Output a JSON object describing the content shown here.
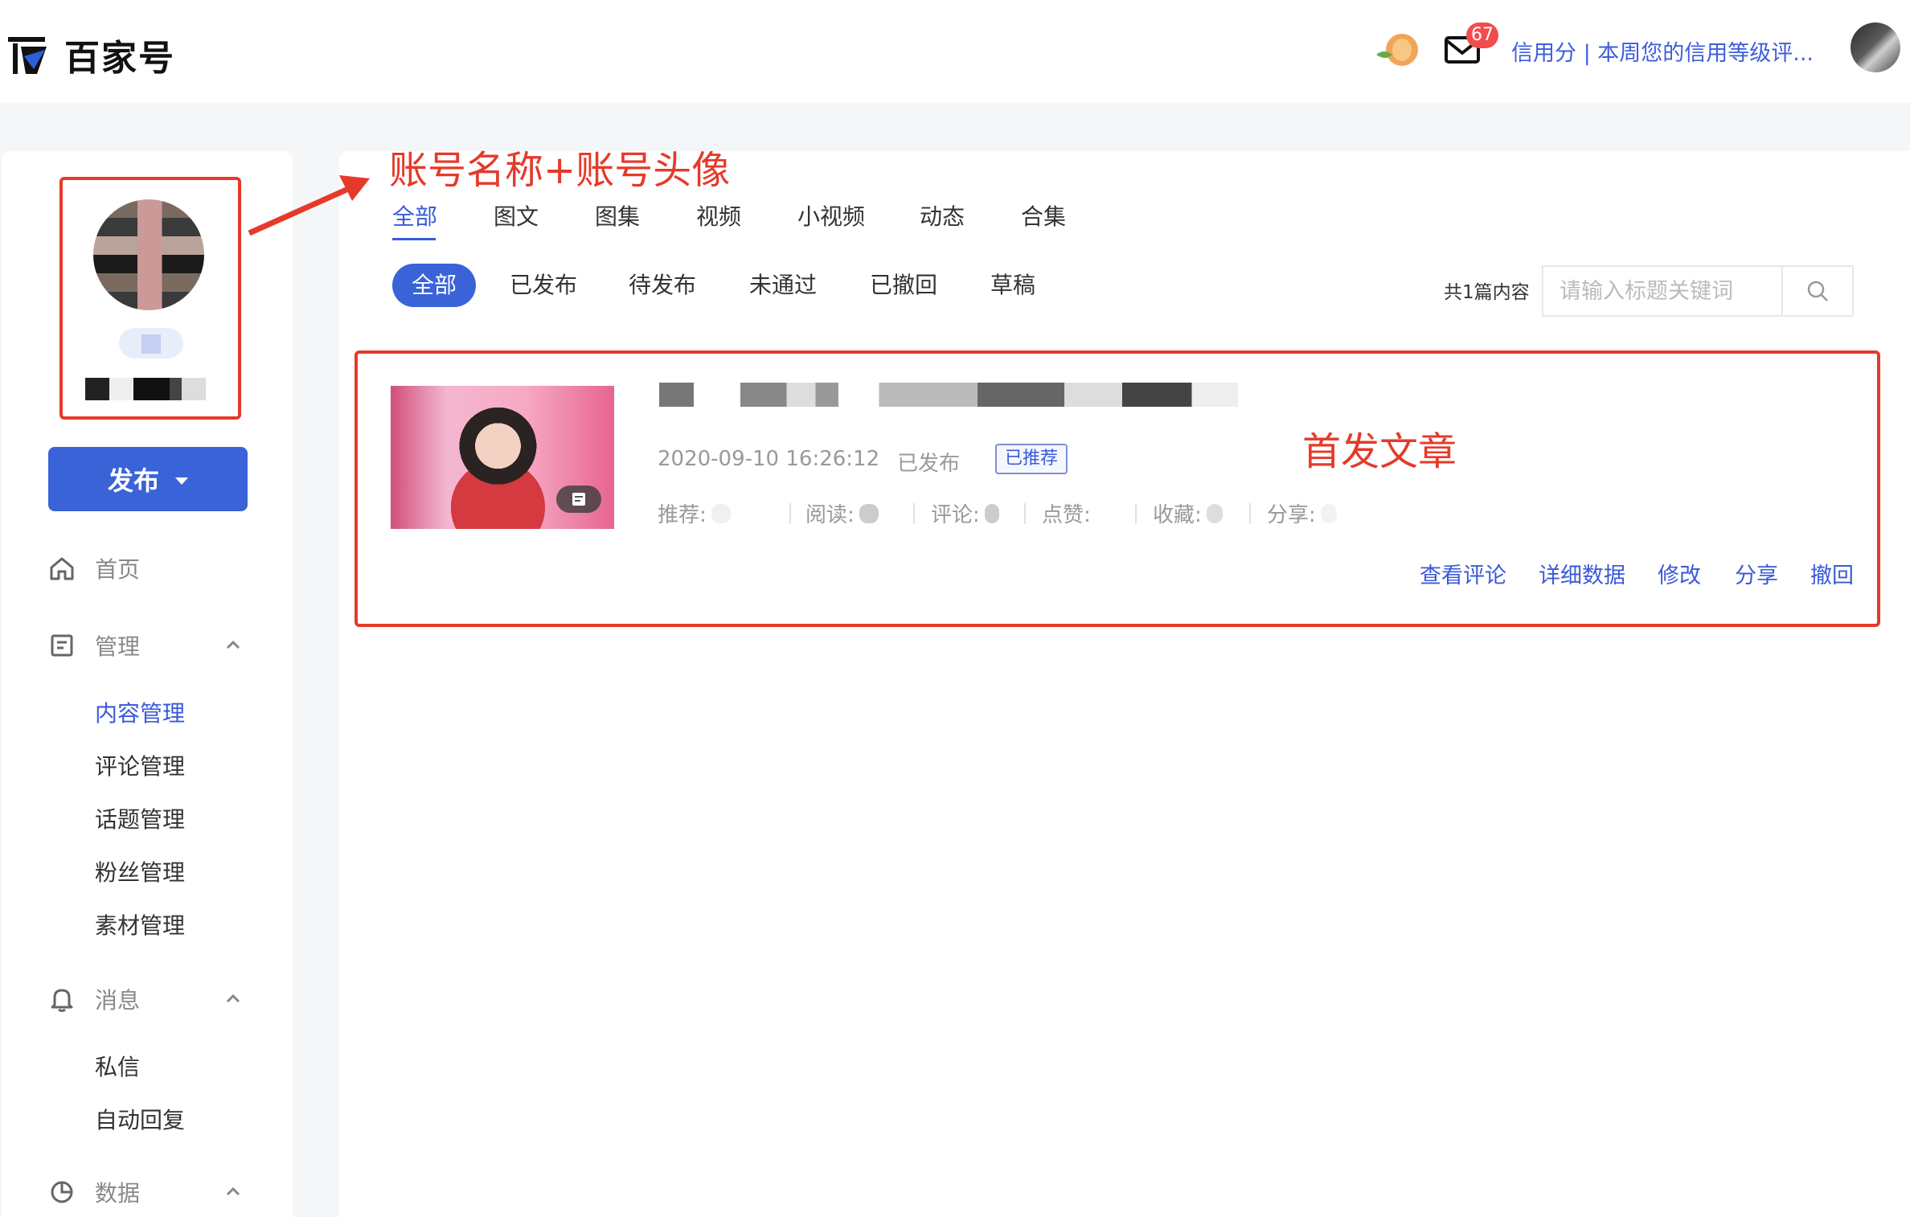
{
  "header": {
    "logo_text": "百家号",
    "mail_badge": "67",
    "credit_text": "信用分 | 本周您的信用等级评..."
  },
  "sidebar": {
    "publish_label": "发布",
    "nav": [
      {
        "label": "首页",
        "icon": "home-icon"
      },
      {
        "label": "管理",
        "icon": "manage-icon",
        "children": [
          "内容管理",
          "评论管理",
          "话题管理",
          "粉丝管理",
          "素材管理"
        ],
        "active_child": "内容管理"
      },
      {
        "label": "消息",
        "icon": "bell-icon",
        "children": [
          "私信",
          "自动回复"
        ]
      },
      {
        "label": "数据",
        "icon": "pie-chart-icon"
      }
    ]
  },
  "annotations": {
    "account": "账号名称+账号头像",
    "first_article": "首发文章"
  },
  "tabs": [
    "全部",
    "图文",
    "图集",
    "视频",
    "小视频",
    "动态",
    "合集"
  ],
  "active_tab": "全部",
  "filters": [
    "全部",
    "已发布",
    "待发布",
    "未通过",
    "已撤回",
    "草稿"
  ],
  "active_filter": "全部",
  "count_text": "共1篇内容",
  "search": {
    "placeholder": "请输入标题关键词"
  },
  "article": {
    "date": "2020-09-10 16:26:12",
    "status": "已发布",
    "tag": "已推荐",
    "stats": [
      {
        "label": "推荐:"
      },
      {
        "label": "阅读:"
      },
      {
        "label": "评论:"
      },
      {
        "label": "点赞:"
      },
      {
        "label": "收藏:"
      },
      {
        "label": "分享:"
      }
    ],
    "actions": [
      "查看评论",
      "详细数据",
      "修改",
      "分享",
      "撤回"
    ]
  },
  "colors": {
    "accent": "#3a63d8",
    "annotation_red": "#e53a2a"
  }
}
